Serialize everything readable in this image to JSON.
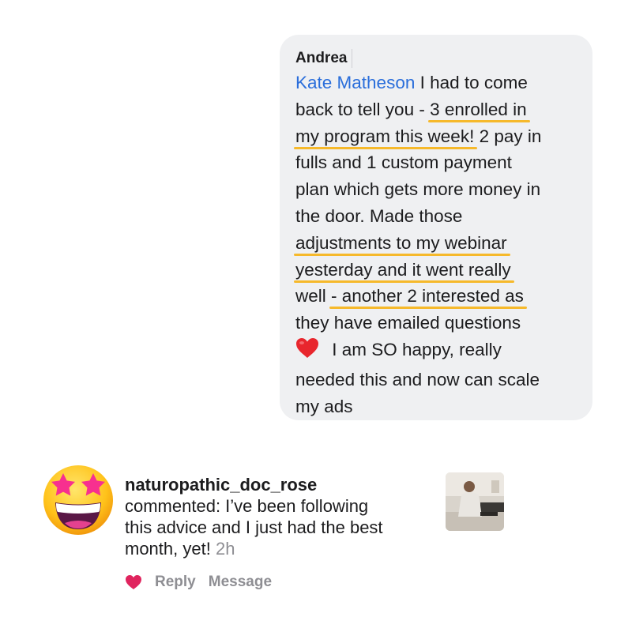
{
  "message": {
    "author": "Andrea",
    "mention": "Kate Matheson",
    "lines": [
      " I had to come",
      "back to tell you - ",
      "3 enrolled in",
      "my program this week!",
      " 2 pay in",
      "fulls and 1 custom payment",
      "plan which gets more money in",
      "the door. Made those",
      "adjustments to my webinar",
      "yesterday and it went really",
      "well ",
      "- another 2 interested as",
      "they have emailed questions",
      " I am SO happy, really",
      "needed this and now can scale",
      "my ads"
    ],
    "emoji": "red-heart-emoji",
    "highlight_color": "#f6b92b",
    "mention_color": "#2a6edb"
  },
  "notification": {
    "username": "naturopathic_doc_rose",
    "text_lines": [
      "commented: I’ve been following",
      "this advice and I just had the best",
      "month, yet! "
    ],
    "time": "2h",
    "avatar_icon": "star-struck-emoji",
    "thumbnail": "post-thumbnail"
  },
  "actions": {
    "like_icon": "heart-icon",
    "like_color": "#e0245e",
    "reply_label": "Reply",
    "message_label": "Message"
  }
}
